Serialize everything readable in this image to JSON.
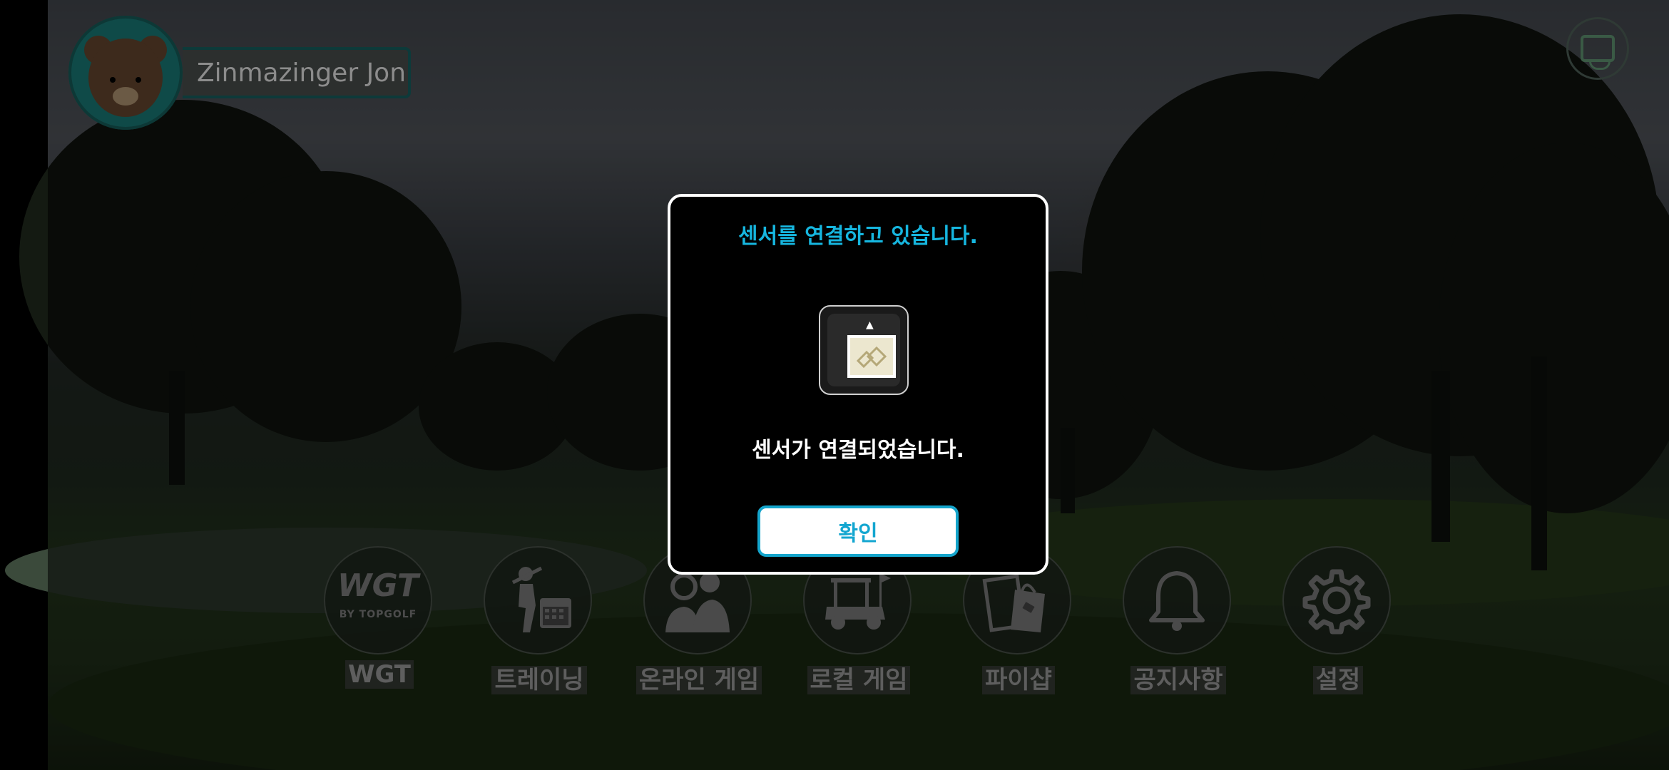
{
  "profile": {
    "player_name": "Zinmazinger Jon",
    "avatar_icon": "bear-avatar-icon"
  },
  "top_right": {
    "icon": "sensor-device-icon"
  },
  "menu": {
    "items": [
      {
        "label": "WGT",
        "icon": "wgt-topgolf-logo",
        "logo_main": "WGT",
        "logo_sub": "BY TOPGOLF"
      },
      {
        "label": "트레이닝",
        "icon": "golfer-calendar-icon"
      },
      {
        "label": "온라인 게임",
        "icon": "players-icon"
      },
      {
        "label": "로컬 게임",
        "icon": "golf-cart-icon"
      },
      {
        "label": "파이샵",
        "icon": "shopping-bags-icon"
      },
      {
        "label": "공지사항",
        "icon": "bell-icon"
      },
      {
        "label": "설정",
        "icon": "gear-icon"
      }
    ]
  },
  "dialog": {
    "title": "센서를 연결하고 있습니다.",
    "icon": "sensor-mat-icon",
    "message": "센서가 연결되었습니다.",
    "confirm_label": "확인"
  },
  "colors": {
    "dialog_title": "#16b6df",
    "confirm_border": "#15a5cc",
    "dialog_border": "#ffffff"
  }
}
